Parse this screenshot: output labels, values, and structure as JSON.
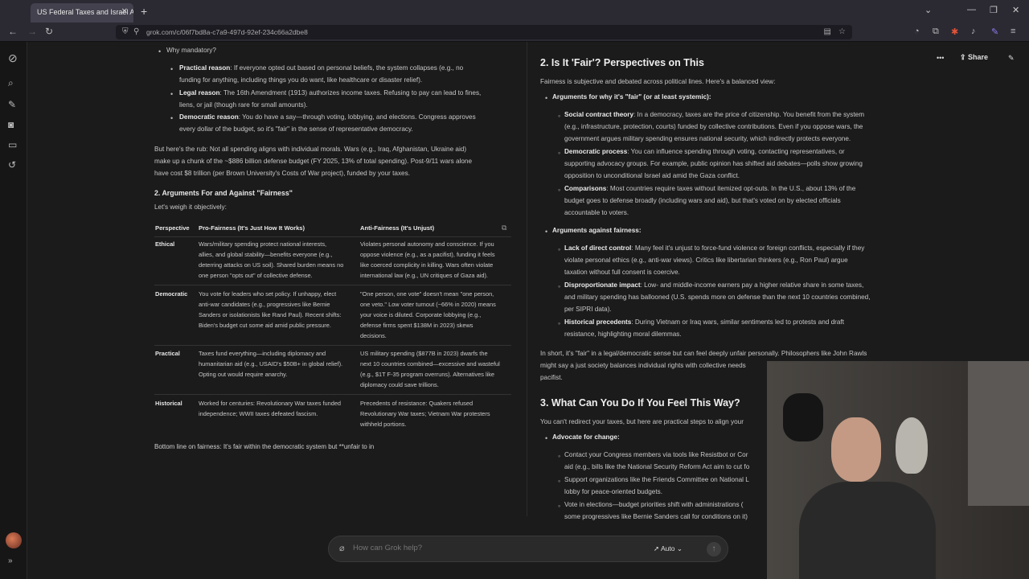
{
  "browser": {
    "tab_title": "US Federal Taxes and Israel Aid",
    "url": "grok.com/c/06f7bd8a-c7a9-497d-92ef-234c66a2dbe8"
  },
  "header": {
    "share_label": "Share"
  },
  "left": {
    "why_mandatory": "Why mandatory?",
    "bullets": [
      {
        "label": "Practical reason",
        "lines": [
          ": If everyone opted out based on personal beliefs, the system collapses (e.g., no",
          "funding for anything, including things you do want, like healthcare or disaster relief)."
        ]
      },
      {
        "label": "Legal reason",
        "lines": [
          ": The 16th Amendment (1913) authorizes income taxes. Refusing to pay can lead to fines,",
          "liens, or jail (though rare for small amounts)."
        ]
      },
      {
        "label": "Democratic reason",
        "lines": [
          ": You do have a say—through voting, lobbying, and elections. Congress approves",
          "every dollar of the budget, so it's \"fair\" in the sense of representative democracy."
        ]
      }
    ],
    "rub_lines": [
      "But here's the rub: Not all spending aligns with individual morals. Wars (e.g., Iraq, Afghanistan, Ukraine aid)",
      "make up a chunk of the ~$886 billion defense budget (FY 2025, 13% of total spending). Post-9/11 wars alone",
      "have cost $8 trillion (per Brown University's Costs of War project), funded by your taxes."
    ],
    "section_heading": "2. Arguments For and Against \"Fairness\"",
    "intro": "Let's weigh it objectively:",
    "table": {
      "headers": [
        "Perspective",
        "Pro-Fairness (It's Just How It Works)",
        "Anti-Fairness (It's Unjust)"
      ],
      "rows": [
        {
          "perspective": "Ethical",
          "pro": [
            "Wars/military spending protect national interests,",
            "allies, and global stability—benefits everyone (e.g.,",
            "deterring attacks on US soil). Shared burden means no",
            "one person \"opts out\" of collective defense."
          ],
          "anti": [
            "Violates personal autonomy and conscience. If you",
            "oppose violence (e.g., as a pacifist), funding it feels",
            "like coerced complicity in killing. Wars often violate",
            "international law (e.g., UN critiques of Gaza aid)."
          ]
        },
        {
          "perspective": "Democratic",
          "pro": [
            "You vote for leaders who set policy. If unhappy, elect",
            "anti-war candidates (e.g., progressives like Bernie",
            "Sanders or isolationists like Rand Paul). Recent shifts:",
            "Biden's budget cut some aid amid public pressure."
          ],
          "anti": [
            "\"One person, one vote\" doesn't mean \"one person,",
            "one veto.\" Low voter turnout (~66% in 2020) means",
            "your voice is diluted. Corporate lobbying (e.g.,",
            "defense firms spent $138M in 2023) skews",
            "decisions."
          ]
        },
        {
          "perspective": "Practical",
          "pro": [
            "Taxes fund everything—including diplomacy and",
            "humanitarian aid (e.g., USAID's $50B+ in global relief).",
            "Opting out would require anarchy."
          ],
          "anti": [
            "US military spending ($877B in 2023) dwarfs the",
            "next 10 countries combined—excessive and wasteful",
            "(e.g., $1T F-35 program overruns). Alternatives like",
            "diplomacy could save trillions."
          ]
        },
        {
          "perspective": "Historical",
          "pro": [
            "Worked for centuries: Revolutionary War taxes funded",
            "independence; WWII taxes defeated fascism."
          ],
          "anti": [
            "Precedents of resistance: Quakers refused",
            "Revolutionary War taxes; Vietnam War protesters",
            "withheld portions."
          ]
        }
      ]
    },
    "bottom_line": "Bottom line on fairness: It's fair within the democratic system but **unfair to in"
  },
  "right": {
    "heading": "2. Is It 'Fair'? Perspectives on This",
    "intro": "Fairness is subjective and debated across political lines. Here's a balanced view:",
    "for_heading": "Arguments for why it's \"fair\" (or at least systemic):",
    "for_items": [
      {
        "label": "Social contract theory",
        "lines": [
          ": In a democracy, taxes are the price of citizenship. You benefit from the system",
          "(e.g., infrastructure, protection, courts) funded by collective contributions. Even if you oppose wars, the",
          "government argues military spending ensures national security, which indirectly protects everyone."
        ]
      },
      {
        "label": "Democratic process",
        "lines": [
          ": You can influence spending through voting, contacting representatives, or",
          "supporting advocacy groups. For example, public opinion has shifted aid debates—polls show growing",
          "opposition to unconditional Israel aid amid the Gaza conflict."
        ]
      },
      {
        "label": "Comparisons",
        "lines": [
          ": Most countries require taxes without itemized opt-outs. In the U.S., about 13% of the",
          "budget goes to defense broadly (including wars and aid), but that's voted on by elected officials",
          "accountable to voters."
        ]
      }
    ],
    "against_heading": "Arguments against fairness:",
    "against_items": [
      {
        "label": "Lack of direct control",
        "lines": [
          ": Many feel it's unjust to force-fund violence or foreign conflicts, especially if they",
          "violate personal ethics (e.g., anti-war views). Critics like libertarian thinkers (e.g., Ron Paul) argue",
          "taxation without full consent is coercive."
        ]
      },
      {
        "label": "Disproportionate impact",
        "lines": [
          ": Low- and middle-income earners pay a higher relative share in some taxes,",
          "and military spending has ballooned (U.S. spends more on defense than the next 10 countries combined,",
          "per SIPRI data)."
        ]
      },
      {
        "label": "Historical precedents",
        "lines": [
          ": During Vietnam or Iraq wars, similar sentiments led to protests and draft",
          "resistance, highlighting moral dilemmas."
        ]
      }
    ],
    "short_lines": [
      "In short, it's \"fair\" in a legal/democratic sense but can feel deeply unfair personally. Philosophers like John Rawls",
      "might say a just society balances individual rights with collective needs",
      "pacifist."
    ],
    "heading3": "3. What Can You Do If You Feel This Way?",
    "intro3": "You can't redirect your taxes, but here are practical steps to align your",
    "advocate": "Advocate for change:",
    "advocate_items": [
      [
        "Contact your Congress members via tools like Resistbot or Cor",
        "aid (e.g., bills like the National Security Reform Act aim to cut fo"
      ],
      [
        "Support organizations like the Friends Committee on National L",
        "lobby for peace-oriented budgets."
      ],
      [
        "Vote in elections—budget priorities shift with administrations (",
        "some progressives like Bernie Sanders call for conditions on it)"
      ]
    ]
  },
  "composer": {
    "placeholder": "How can Grok help?",
    "mode": "Auto"
  }
}
